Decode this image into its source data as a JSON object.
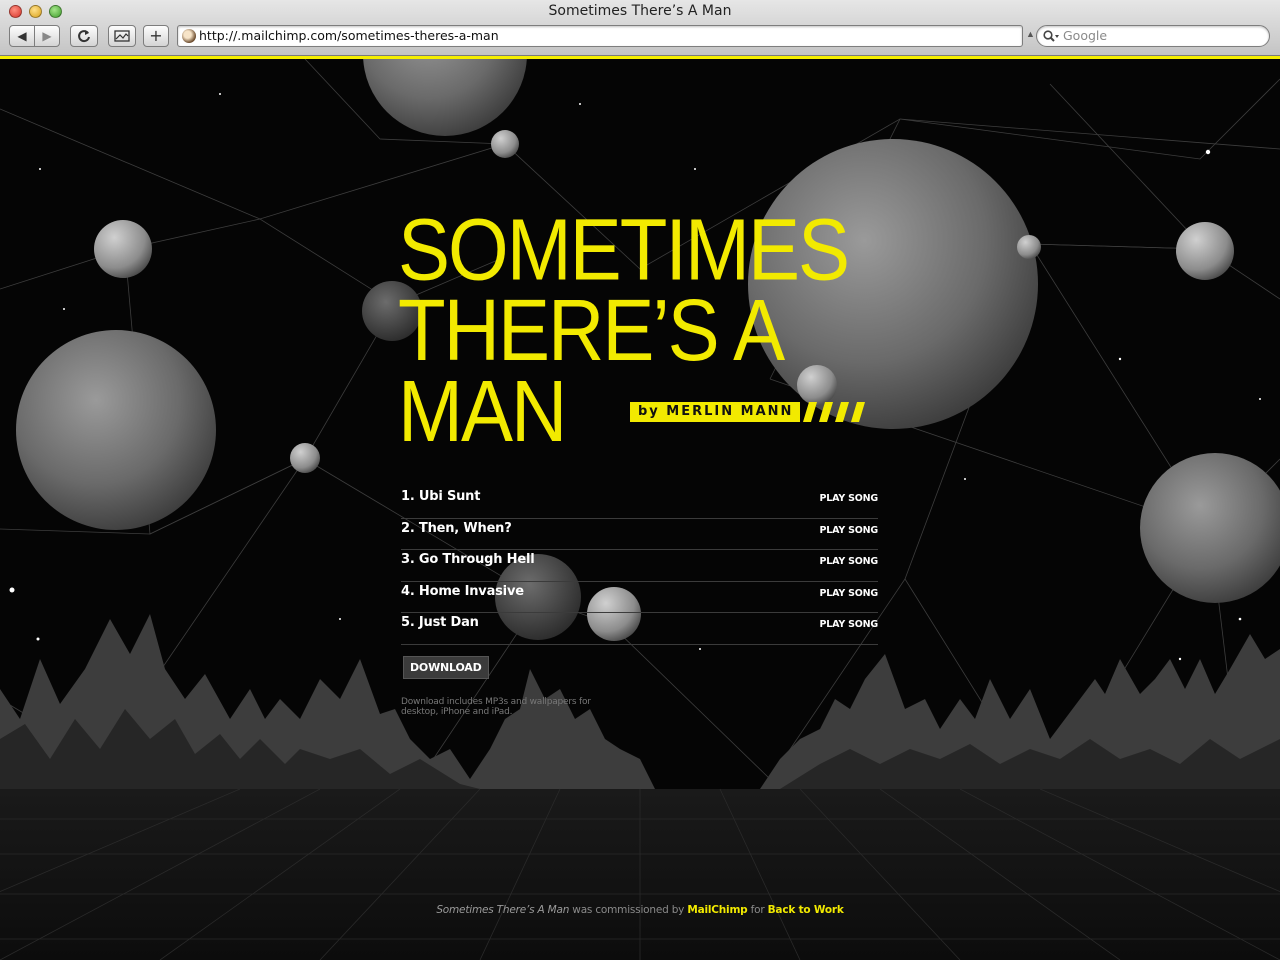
{
  "window": {
    "title": "Sometimes There’s A Man"
  },
  "toolbar": {
    "back_icon": "left-arrow-icon",
    "forward_icon": "right-arrow-icon",
    "reload_icon": "reload-icon",
    "snapshot_icon": "snapshot-icon",
    "add_icon": "plus-icon"
  },
  "address_bar": {
    "url": "http://.mailchimp.com/sometimes-theres-a-man"
  },
  "search_bar": {
    "placeholder": "Google"
  },
  "hero": {
    "title_line_1": "SOMETIMES",
    "title_line_2": "THERE’S A",
    "title_line_3": "MAN",
    "byline": "by MERLIN MANN"
  },
  "tracks": [
    {
      "title": "1. Ubi Sunt",
      "action": "PLAY SONG"
    },
    {
      "title": "2. Then, When?",
      "action": "PLAY SONG"
    },
    {
      "title": "3. Go Through Hell",
      "action": "PLAY SONG"
    },
    {
      "title": "4. Home Invasive",
      "action": "PLAY SONG"
    },
    {
      "title": "5. Just Dan",
      "action": "PLAY SONG"
    }
  ],
  "download": {
    "label": "DOWNLOAD",
    "note": "Download includes MP3s and wallpapers for desktop, iPhone and iPad."
  },
  "footer": {
    "work_title": "Sometimes There’s A Man",
    "text_1": " was commissioned by ",
    "sponsor_link": "MailChimp",
    "text_2": " for ",
    "project_link": "Back to Work"
  },
  "colors": {
    "accent": "#f2ea00",
    "background": "#050505",
    "text": "#ffffff",
    "muted": "#777777"
  }
}
